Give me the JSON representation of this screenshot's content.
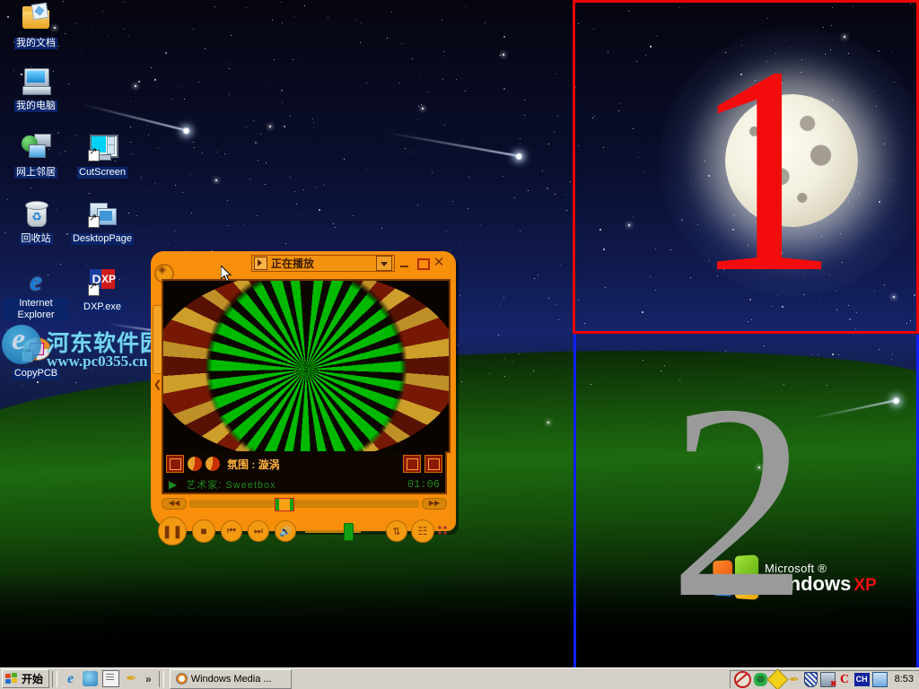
{
  "desktop": {
    "icons": [
      {
        "name": "my-documents",
        "label": "我的文档",
        "icon": "folder-documents-icon",
        "shortcut": false
      },
      {
        "name": "my-computer",
        "label": "我的电脑",
        "icon": "computer-icon",
        "shortcut": false
      },
      {
        "name": "network-neighborhood",
        "label": "网上邻居",
        "icon": "network-icon",
        "shortcut": false
      },
      {
        "name": "recycle-bin",
        "label": "回收站",
        "icon": "recycle-bin-icon",
        "shortcut": false
      },
      {
        "name": "internet-explorer",
        "label": "Internet Explorer",
        "icon": "ie-icon",
        "shortcut": false
      },
      {
        "name": "cutscreen",
        "label": "CutScreen",
        "icon": "cutscreen-icon",
        "shortcut": true
      },
      {
        "name": "desktoppage",
        "label": "DesktopPage",
        "icon": "desktoppage-icon",
        "shortcut": true
      },
      {
        "name": "dxp-exe",
        "label": "DXP.exe",
        "icon": "dxp-icon",
        "shortcut": true
      },
      {
        "name": "copypcb",
        "label": "CopyPCB",
        "icon": "copypcb-icon",
        "shortcut": true
      }
    ]
  },
  "watermark": {
    "site_name": "河东软件园",
    "url": "www.pc0355.cn"
  },
  "regions": {
    "region_one_marker": "1",
    "region_one_border_color": "#ee0000",
    "region_two_marker": "2",
    "region_two_border_color": "#1020ff"
  },
  "branding": {
    "microsoft": "Microsoft ®",
    "windows": "Windows",
    "xp": "XP"
  },
  "player": {
    "title": "正在播放",
    "title_icon": "now-playing-icon",
    "dropdown_icon": "chevron-down-icon",
    "window_buttons": {
      "minimize": "minimize-icon",
      "maximize": "maximize-icon",
      "close": "close-icon"
    },
    "visualization": {
      "label": "氛围 : 漩涡",
      "ambience": "氛围",
      "preset": "漩涡"
    },
    "artist_line": "艺术家: Sweetbox",
    "artist_label": "艺术家",
    "artist": "Sweetbox",
    "time": "01:06",
    "seek_position_percent": 37,
    "volume_percent": 70,
    "controls": {
      "play_pause": "pause-icon",
      "stop": "stop-icon",
      "previous": "previous-track-icon",
      "next": "next-track-icon",
      "mute": "volume-icon",
      "rewind": "rewind-icon",
      "fast_forward": "fast-forward-icon",
      "shuffle": "shuffle-icon",
      "playlist": "playlist-icon"
    },
    "info_buttons": {
      "left": "video-settings-icon",
      "right_prev": "previous-visual-icon",
      "right_expand": "expand-visual-icon"
    }
  },
  "taskbar": {
    "start_label": "开始",
    "start_icon": "windows-flag-icon",
    "quick_launch": [
      {
        "name": "ie-quick",
        "icon": "ie-icon"
      },
      {
        "name": "show-desktop-quick",
        "icon": "show-desktop-icon"
      },
      {
        "name": "notepad-quick",
        "icon": "notepad-icon"
      },
      {
        "name": "pen-quick",
        "icon": "pen-icon"
      }
    ],
    "overflow_label": "»",
    "window_button": {
      "label": "Windows Media ...",
      "icon": "windows-media-player-icon"
    },
    "tray": [
      {
        "name": "antivirus-tray",
        "icon": "antivirus-icon"
      },
      {
        "name": "turtle-tray",
        "icon": "turtle-icon"
      },
      {
        "name": "yellow-tool-tray",
        "icon": "diamond-icon"
      },
      {
        "name": "pen-tray",
        "icon": "pen-icon"
      },
      {
        "name": "shield-tray",
        "icon": "shield-icon"
      },
      {
        "name": "network-tray",
        "icon": "network-disconnected-icon"
      },
      {
        "name": "c-tray",
        "icon": "letter-c-icon"
      },
      {
        "name": "ime-tray",
        "icon": "ime-ch-icon"
      },
      {
        "name": "display-tray",
        "icon": "monitor-icon"
      }
    ],
    "clock": "8:53"
  }
}
